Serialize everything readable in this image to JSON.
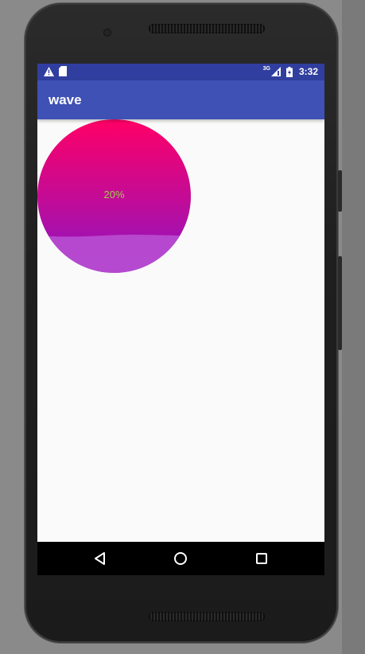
{
  "status_bar": {
    "left_icons": [
      "warning-icon",
      "sd-card-icon"
    ],
    "network": "3G",
    "time": "3:32",
    "icons": [
      "signal-icon",
      "battery-icon"
    ]
  },
  "app_bar": {
    "title": "wave"
  },
  "wave_view": {
    "progress_text": "20%",
    "progress": 0.2,
    "colors": {
      "top": "#ff0066",
      "bottom": "#8a16c4",
      "wave": "#b64ad0",
      "text": "#9ad04a"
    }
  },
  "nav_bar": {
    "buttons": [
      "back-icon",
      "home-icon",
      "recents-icon"
    ]
  },
  "colors": {
    "status_bar": "#303f9f",
    "app_bar": "#3f51b5",
    "screen_bg": "#fafafa",
    "nav_bar": "#000000"
  }
}
